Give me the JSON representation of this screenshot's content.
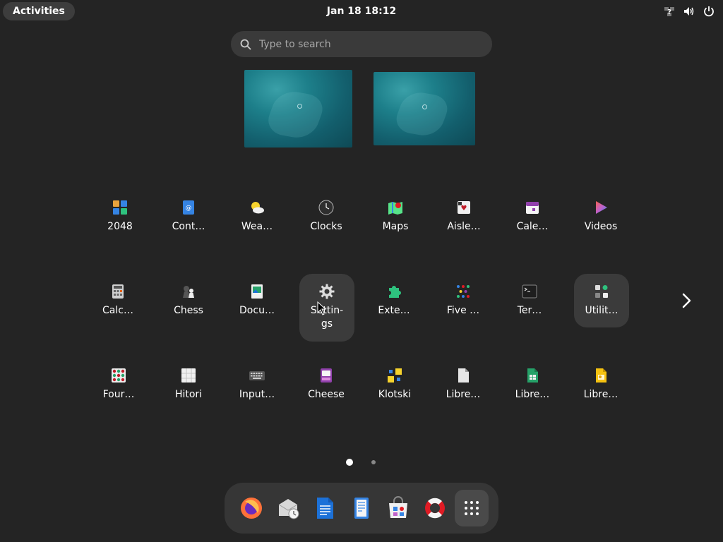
{
  "topbar": {
    "activities_label": "Activities",
    "clock": "Jan 18  18:12"
  },
  "search": {
    "placeholder": "Type to search"
  },
  "apps": {
    "row1": [
      "2048",
      "Cont…",
      "Wea…",
      "Clocks",
      "Maps",
      "Aisle…",
      "Cale…",
      "Videos"
    ],
    "row2": [
      "Calc…",
      "Chess",
      "Docu…",
      "Settin-\ngs",
      "Exte…",
      "Five …",
      "Ter…",
      "Utilit…"
    ],
    "row3": [
      "Four…",
      "Hitori",
      "Input…",
      "Cheese",
      "Klotski",
      "Libre…",
      "Libre…",
      "Libre…"
    ]
  },
  "pagination": {
    "total_pages": 2,
    "current_page": 1
  },
  "dock": {
    "items": [
      "firefox-icon",
      "evolution-mail-icon",
      "writer-icon",
      "text-editor-icon",
      "software-icon",
      "help-icon",
      "show-apps-icon"
    ]
  },
  "colors": {
    "background": "#242424",
    "accent_blue": "#3584e4"
  }
}
